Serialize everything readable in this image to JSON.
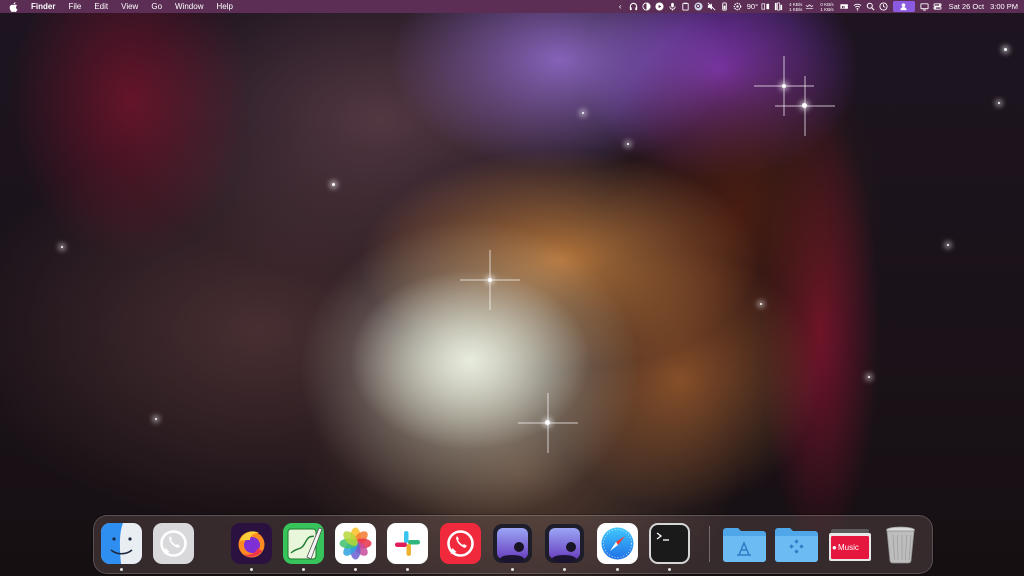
{
  "menubar": {
    "app_name": "Finder",
    "menus": [
      "File",
      "Edit",
      "View",
      "Go",
      "Window",
      "Help"
    ],
    "status": {
      "temperature": "90°",
      "net_up": "4 KB/s",
      "net_down": "1 KB/s",
      "net2_up": "0 KB/s",
      "net2_down": "1 KB/s",
      "date": "Sat 26 Oct",
      "time": "3:00 PM"
    }
  },
  "dock": {
    "apps": [
      {
        "name": "Finder",
        "icon": "finder-icon"
      },
      {
        "name": "WhatsApp (gray)",
        "icon": "whatsapp-gray-icon"
      },
      {
        "name": "Firefox",
        "icon": "firefox-icon"
      },
      {
        "name": "Maps / Writer",
        "icon": "pen-map-icon"
      },
      {
        "name": "Photos",
        "icon": "photos-icon"
      },
      {
        "name": "Slack",
        "icon": "slack-icon"
      },
      {
        "name": "WhatsApp",
        "icon": "whatsapp-icon"
      },
      {
        "name": "Preview 1",
        "icon": "preview-icon"
      },
      {
        "name": "Preview 2",
        "icon": "preview-icon"
      },
      {
        "name": "Safari",
        "icon": "safari-icon"
      },
      {
        "name": "Terminal",
        "icon": "terminal-icon"
      }
    ],
    "folders": [
      {
        "name": "Applications",
        "icon": "applications-folder-icon"
      },
      {
        "name": "Downloads",
        "icon": "downloads-folder-icon"
      }
    ],
    "music_label": "Music",
    "trash": {
      "name": "Trash",
      "icon": "trash-icon"
    }
  },
  "colors": {
    "menubar_bg": "#5c2e55",
    "menubar_highlight": "#8a5ae0",
    "folder_blue": "#4fa6e8"
  }
}
